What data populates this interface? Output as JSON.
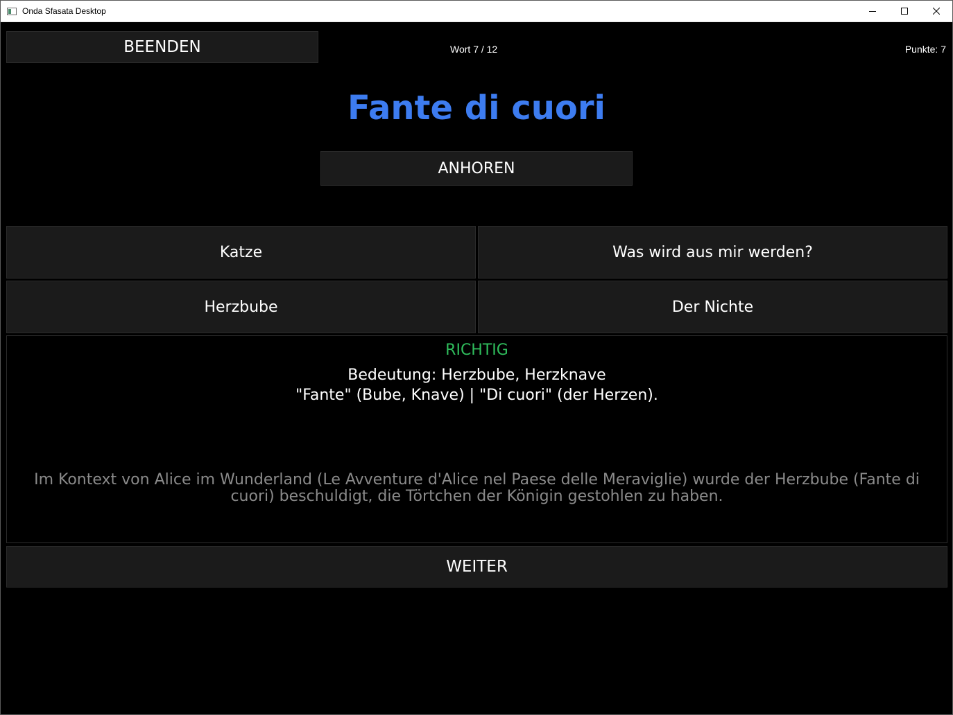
{
  "window": {
    "title": "Onda Sfasata Desktop",
    "controls": [
      "minimize-icon",
      "maximize-icon",
      "close-icon"
    ]
  },
  "header": {
    "quit_label": "BEENDEN",
    "word_counter": "Wort 7 / 12",
    "score": "Punkte: 7"
  },
  "word": {
    "text": "Fante di cuori",
    "color": "#3d7cf0"
  },
  "listen_label": "ANHOREN",
  "answers": [
    {
      "label": "Katze"
    },
    {
      "label": "Was wird aus mir werden?"
    },
    {
      "label": "Herzbube"
    },
    {
      "label": "Der Nichte"
    }
  ],
  "feedback": {
    "status": "RICHTIG",
    "status_color": "#2fbd5c",
    "meaning_line1": "Bedeutung: Herzbube, Herzknave",
    "meaning_line2": "\"Fante\" (Bube, Knave) | \"Di cuori\" (der Herzen).",
    "context": "Im Kontext von Alice im Wunderland (Le Avventure d'Alice nel Paese delle Meraviglie) wurde der Herzbube (Fante di cuori) beschuldigt, die Törtchen der Königin gestohlen zu haben."
  },
  "next_label": "WEITER"
}
